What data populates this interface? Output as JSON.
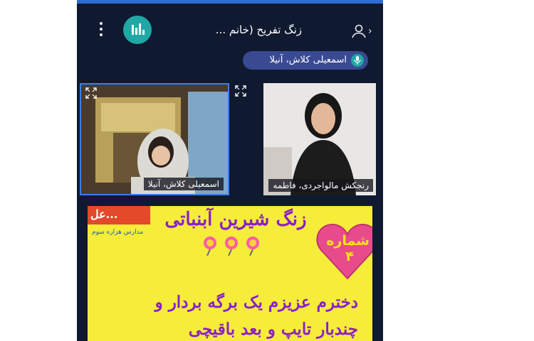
{
  "header": {
    "title": "زنگ تفریح (خانم ...",
    "icons": {
      "menu": "kebab-icon",
      "participants": "bars-icon",
      "user": "user-icon",
      "back": "chevron-icon"
    }
  },
  "speaker": {
    "name": "اسمعیلی کلاش، آنیلا",
    "icon": "mic-icon"
  },
  "tiles": [
    {
      "name": "اسمعیلی کلاش، آنیلا"
    },
    {
      "name": "رنجکش مالواجردی، فاطمه"
    }
  ],
  "poster": {
    "logo": "عل...",
    "brand_sub": "مدارس هزاره سوم",
    "title": "زنگ شیرین آبنباتی",
    "badge": "شماره ۴",
    "line1": "دخترم عزیزم  یک برگه بردار و",
    "line2": "چندبار تایپ و بعد باقیچی"
  },
  "colors": {
    "accent": "#1fa8a5",
    "pill": "#3a4a92",
    "border": "#3b7fe8",
    "poster_bg": "#f6ec3a",
    "poster_text": "#8a1fc9",
    "heart": "#e84b8c"
  }
}
